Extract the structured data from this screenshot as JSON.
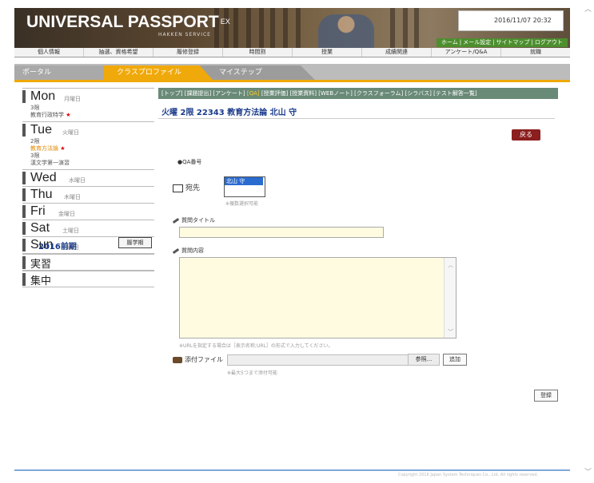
{
  "header": {
    "logo": "UNIVERSAL PASSPORT",
    "logo_sup": "EX",
    "logo_sub": "HAKKEN SERVICE",
    "datetime": "2016/11/07 20:32",
    "top_links": [
      "ホーム",
      "メール設定",
      "サイトマップ",
      "ログアウト"
    ]
  },
  "main_menu": [
    "個人情報",
    "抽選、資格希望",
    "履修登録",
    "時間割",
    "授業",
    "成績関連",
    "アンケート/Q&A",
    "就職"
  ],
  "tabs": [
    "ポータル",
    "クラスプロファイル",
    "マイステップ"
  ],
  "sidebar": {
    "days": [
      {
        "en": "Mon",
        "jp": "月曜日",
        "periods": [
          {
            "num": "3限",
            "name": "教育行政特学",
            "star": true,
            "orange": false
          }
        ]
      },
      {
        "en": "Tue",
        "jp": "火曜日",
        "periods": [
          {
            "num": "2限",
            "name": "教育方法論",
            "star": true,
            "orange": true
          },
          {
            "num": "3限",
            "name": "漢文学第一演習",
            "star": false,
            "orange": false
          }
        ]
      },
      {
        "en": "Wed",
        "jp": "水曜日",
        "periods": []
      },
      {
        "en": "Thu",
        "jp": "木曜日",
        "periods": []
      },
      {
        "en": "Fri",
        "jp": "金曜日",
        "periods": []
      },
      {
        "en": "Sat",
        "jp": "土曜日",
        "periods": []
      },
      {
        "en": "Sun",
        "jp": "日曜日",
        "periods": []
      }
    ],
    "extra": [
      "実習",
      "集中"
    ],
    "term": "2016前期",
    "term_button": "履学期"
  },
  "content": {
    "subnav": [
      "トップ",
      "課題提出",
      "アンケート",
      "QA",
      "授業評価",
      "授業資料",
      "WEBノート",
      "クラスフォーラム",
      "シラバス",
      "テスト解答一覧"
    ],
    "subnav_active": "QA",
    "course_title": "火曜 2限 22343 教育方法論 北山 守",
    "back_button": "戻る",
    "qa_number_label": "●QA番号",
    "address_label": "宛先",
    "address_selected": "北山 守",
    "address_note": "※複数選択可能",
    "question_title_label": "質問タイトル",
    "question_title_value": "",
    "question_body_label": "質問内容",
    "question_body_value": "",
    "url_note": "※URLを指定する場合は［表示名称;URL］の形式で入力してください。",
    "attach_label": "添付ファイル",
    "browse_button": "参照...",
    "add_button": "追加",
    "attach_note": "※最大5つまで添付可能",
    "submit_button": "登録"
  },
  "footer": {
    "copyright": "Copyright 2016 Japan System Techniques Co., Ltd. All rights reserved."
  }
}
